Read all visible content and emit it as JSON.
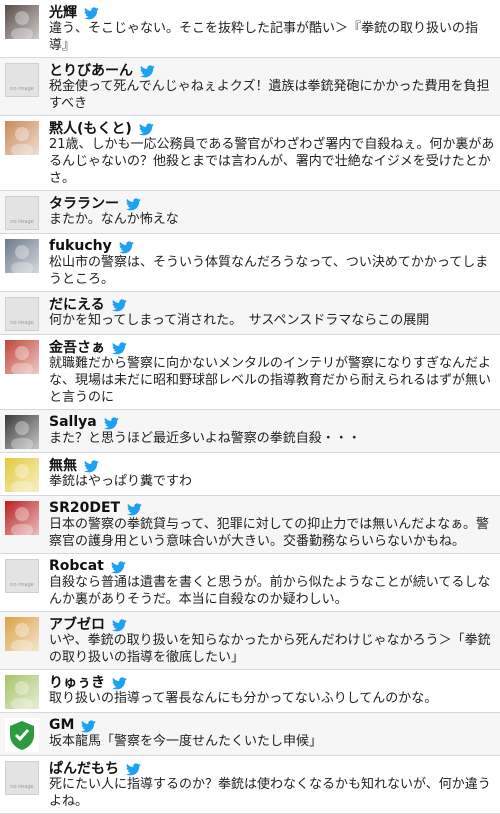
{
  "tweets": [
    {
      "name": "光輝",
      "text": "違う、そこじゃない。そこを抜粋した記事が酷い＞『拳銃の取り扱いの指導』",
      "avatar": "photo",
      "color": "#5a4b48"
    },
    {
      "name": "とりびあーん",
      "text": "税金使って死んでんじゃねぇよクズ！遺族は拳銃発砲にかかった費用を負担すべき",
      "avatar": "noimage"
    },
    {
      "name": "黙人(もくと)",
      "text": "21歳、しかも一応公務員である警官がわざわざ署内で自殺ねぇ。何か裏があるんじゃないの？他殺とまでは言わんが、署内で壮絶なイジメを受けたとかさ。",
      "avatar": "photo",
      "color": "#c98a5a"
    },
    {
      "name": "タラランー",
      "text": "またか。なんか怖えな",
      "avatar": "noimage"
    },
    {
      "name": "fukuchy",
      "text": "松山市の警察は、そういう体質なんだろうなって、つい決めてかかってしまうところ。",
      "avatar": "photo",
      "color": "#6d7a8a"
    },
    {
      "name": "だにえる",
      "text": "何かを知ってしまって消された。　サスペンスドラマならこの展開",
      "avatar": "noimage"
    },
    {
      "name": "金吾さぁ",
      "text": "就職難だから警察に向かないメンタルのインテリが警察になりすぎなんだよな、現場は未だに昭和野球部レベルの指導教育だから耐えられるはずが無いと言うのに",
      "avatar": "photo",
      "color": "#c0463a"
    },
    {
      "name": "Sallya",
      "text": "また？と思うほど最近多いよね警察の拳銃自殺・・・",
      "avatar": "photo",
      "color": "#3a3a3a"
    },
    {
      "name": "無無",
      "text": "拳銃はやっぱり糞ですわ",
      "avatar": "photo",
      "color": "#e3c93b"
    },
    {
      "name": "SR20DET",
      "text": "日本の警察の拳銃貸与って、犯罪に対しての抑止力では無いんだよなぁ。警察官の護身用という意味合いが大きい。交番勤務ならいらないかもね。",
      "avatar": "photo",
      "color": "#b81f1f"
    },
    {
      "name": "Robcat",
      "text": "自殺なら普通は遺書を書くと思うが。前から似たようなことが続いてるしなんか裏がありそうだ。本当に自殺なのか疑わしい。",
      "avatar": "noimage"
    },
    {
      "name": "アブゼロ",
      "text": "いや、拳銃の取り扱いを知らなかったから死んだわけじゃなかろう＞「拳銃の取り扱いの指導を徹底したい」",
      "avatar": "photo",
      "color": "#d8a24a"
    },
    {
      "name": "りゅぅき",
      "text": "取り扱いの指導って署長なんにも分かってないふりしてんのかな。",
      "avatar": "photo",
      "color": "#a7c36a"
    },
    {
      "name": "GM",
      "text": "坂本龍馬「警察を今一度せんたくいたし申候」",
      "avatar": "shield",
      "color": "#2e9a3e"
    },
    {
      "name": "ぱんだもち",
      "text": "死にたい人に指導するのか？拳銃は使わなくなるかも知れないが、何か違うよね。",
      "avatar": "noimage"
    }
  ],
  "no_image_label": "no image",
  "bird_color": "#1da1f2"
}
